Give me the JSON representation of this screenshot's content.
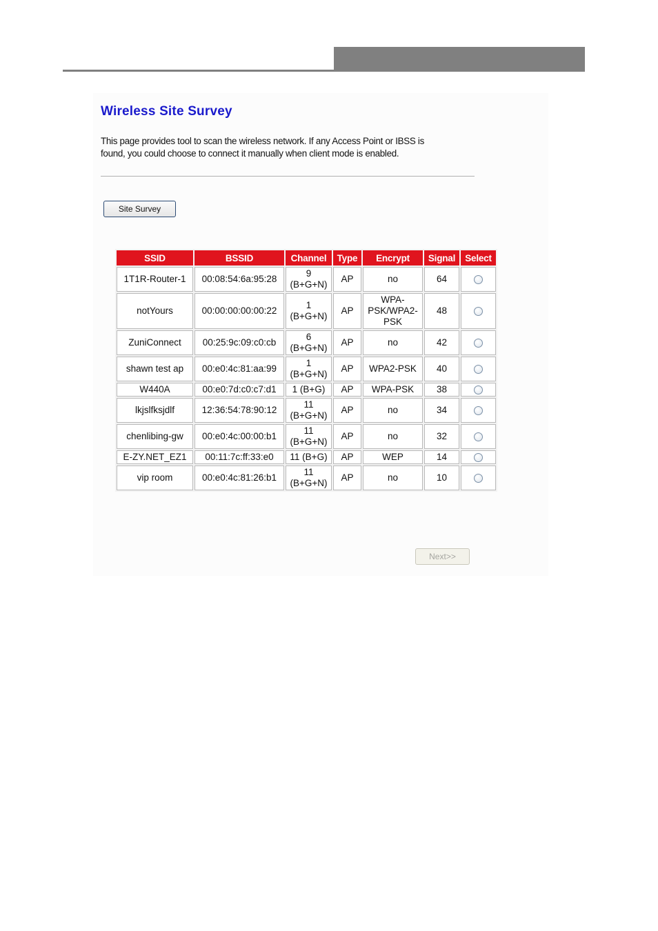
{
  "page": {
    "title": "Wireless Site Survey",
    "description": "This page provides tool to scan the wireless network. If any Access Point or IBSS is found, you could choose to connect it manually when client mode is enabled.",
    "site_survey_button": "Site Survey",
    "next_button": "Next>>",
    "colors": {
      "title": "#1a1acc",
      "header_bg": "#e0141e",
      "banner": "#808080"
    }
  },
  "table": {
    "columns": [
      "SSID",
      "BSSID",
      "Channel",
      "Type",
      "Encrypt",
      "Signal",
      "Select"
    ],
    "rows": [
      {
        "ssid": "1T1R-Router-1",
        "bssid": "00:08:54:6a:95:28",
        "channel": "9 (B+G+N)",
        "type": "AP",
        "encrypt": "no",
        "signal": "64",
        "selected": false
      },
      {
        "ssid": "notYours",
        "bssid": "00:00:00:00:00:22",
        "channel": "1 (B+G+N)",
        "type": "AP",
        "encrypt": "WPA-PSK/WPA2-PSK",
        "signal": "48",
        "selected": false
      },
      {
        "ssid": "ZuniConnect",
        "bssid": "00:25:9c:09:c0:cb",
        "channel": "6 (B+G+N)",
        "type": "AP",
        "encrypt": "no",
        "signal": "42",
        "selected": false
      },
      {
        "ssid": "shawn test ap",
        "bssid": "00:e0:4c:81:aa:99",
        "channel": "1 (B+G+N)",
        "type": "AP",
        "encrypt": "WPA2-PSK",
        "signal": "40",
        "selected": false
      },
      {
        "ssid": "W440A",
        "bssid": "00:e0:7d:c0:c7:d1",
        "channel": "1 (B+G)",
        "type": "AP",
        "encrypt": "WPA-PSK",
        "signal": "38",
        "selected": false
      },
      {
        "ssid": "lkjslfksjdlf",
        "bssid": "12:36:54:78:90:12",
        "channel": "11 (B+G+N)",
        "type": "AP",
        "encrypt": "no",
        "signal": "34",
        "selected": false
      },
      {
        "ssid": "chenlibing-gw",
        "bssid": "00:e0:4c:00:00:b1",
        "channel": "11 (B+G+N)",
        "type": "AP",
        "encrypt": "no",
        "signal": "32",
        "selected": false
      },
      {
        "ssid": "E-ZY.NET_EZ1",
        "bssid": "00:11:7c:ff:33:e0",
        "channel": "11 (B+G)",
        "type": "AP",
        "encrypt": "WEP",
        "signal": "14",
        "selected": false
      },
      {
        "ssid": "vip room",
        "bssid": "00:e0:4c:81:26:b1",
        "channel": "11 (B+G+N)",
        "type": "AP",
        "encrypt": "no",
        "signal": "10",
        "selected": false
      }
    ]
  }
}
